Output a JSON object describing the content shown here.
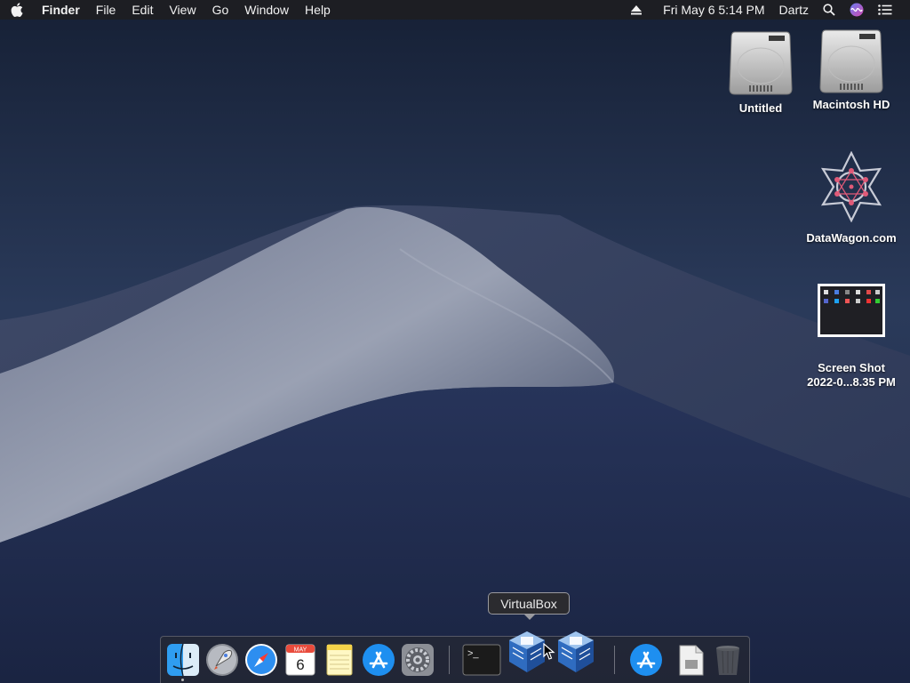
{
  "menubar": {
    "app_name": "Finder",
    "menus": [
      "File",
      "Edit",
      "View",
      "Go",
      "Window",
      "Help"
    ],
    "clock": "Fri May 6  5:14 PM",
    "user": "Dartz"
  },
  "desktop_icons": [
    {
      "label": "Untitled",
      "icon": "hard-drive-icon"
    },
    {
      "label": "Macintosh HD",
      "icon": "hard-drive-icon"
    },
    {
      "label": "DataWagon.com",
      "icon": "datawagon-logo-icon"
    },
    {
      "label_line1": "Screen Shot",
      "label_line2": "2022-0...8.35 PM",
      "icon": "screenshot-thumbnail-icon"
    }
  ],
  "dock": {
    "tooltip": "VirtualBox",
    "calendar_month": "MAY",
    "calendar_day": "6",
    "terminal_prompt": ">_",
    "items": [
      "Finder",
      "Launchpad",
      "Safari",
      "Calendar",
      "Notes",
      "App Store",
      "System Preferences",
      "Terminal",
      "VirtualBox",
      "VirtualBox",
      "App Store Downloads",
      "Documents",
      "Trash"
    ]
  },
  "colors": {
    "menubar_bg": "#1e1e22",
    "wallpaper_sky": "#1c2740",
    "dune_light": "#8a92a6"
  }
}
